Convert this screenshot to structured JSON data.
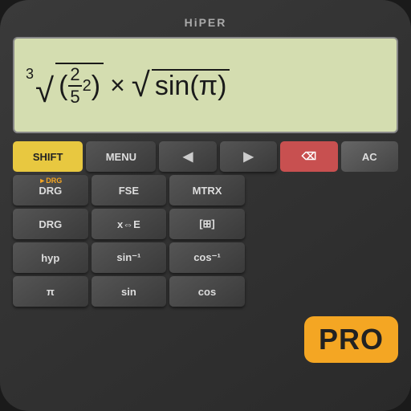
{
  "app": {
    "title": "HiPER",
    "display": {
      "expression": "3√((2/5)²) × √sin(π)"
    }
  },
  "keyboard": {
    "row1": [
      {
        "label": "SHIFT",
        "type": "shift",
        "top": ""
      },
      {
        "label": "MENU",
        "type": "dark",
        "top": ""
      },
      {
        "label": "◀",
        "type": "nav",
        "top": ""
      },
      {
        "label": "▶",
        "type": "nav",
        "top": ""
      },
      {
        "label": "⌫",
        "type": "backspace",
        "top": ""
      },
      {
        "label": "AC",
        "type": "ac",
        "top": ""
      }
    ],
    "row2": [
      {
        "label": "DRG",
        "type": "dark",
        "top": "►DRG"
      },
      {
        "label": "FSE",
        "type": "dark",
        "top": ""
      },
      {
        "label": "MTRX",
        "type": "dark",
        "top": ""
      }
    ],
    "row3": [
      {
        "label": "DRG",
        "type": "dark",
        "top": ""
      },
      {
        "label": "x⇔E",
        "type": "dark",
        "top": ""
      },
      {
        "label": "[⊞]",
        "type": "dark",
        "top": ""
      }
    ],
    "row4": [
      {
        "label": "hyp",
        "type": "dark",
        "top": ""
      },
      {
        "label": "sin⁻¹",
        "type": "dark",
        "top": ""
      },
      {
        "label": "cos⁻¹",
        "type": "dark",
        "top": ""
      }
    ],
    "row5": [
      {
        "label": "π",
        "type": "dark",
        "top": ""
      },
      {
        "label": "sin",
        "type": "dark",
        "top": ""
      },
      {
        "label": "cos",
        "type": "dark",
        "top": ""
      }
    ]
  },
  "pro_badge": {
    "label": "PRO"
  },
  "colors": {
    "display_bg": "#d4ddb0",
    "btn_shift": "#e8c840",
    "btn_backspace": "#c85050",
    "btn_dark": "#444",
    "top_label": "#f4a623",
    "pro_badge_bg": "#f4a623"
  }
}
